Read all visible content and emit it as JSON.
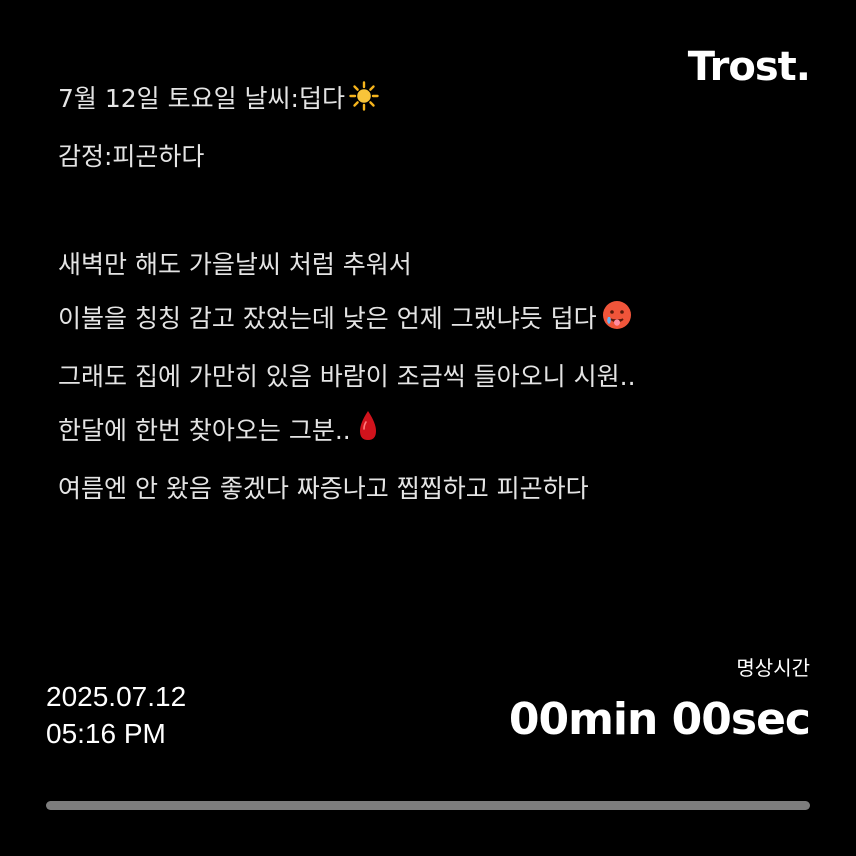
{
  "brand": {
    "logo": "Trost."
  },
  "entry": {
    "line1": "7월 12일 토요일 날씨:덥다",
    "line1_icon": "sun-emoji",
    "line2": "감정:피곤하다",
    "line3": "새벽만 해도 가을날씨 처럼 추워서",
    "line4": "이불을 칭칭 감고 잤었는데 낮은 언제 그랬냐듯 덥다",
    "line4_icon": "hot-face-emoji",
    "line5": "그래도 집에 가만히 있음 바람이 조금씩 들아오니 시원..",
    "line6": "한달에 한번 찾아오는 그분..",
    "line6_icon": "drop-of-blood-emoji",
    "line7": "여름엔 안 왔음 좋겠다 짜증나고 찝찝하고 피곤하다"
  },
  "meta": {
    "date": "2025.07.12",
    "time": "05:16 PM"
  },
  "meditation": {
    "label": "명상시간",
    "timer": "00min 00sec",
    "progress": 0
  },
  "colors": {
    "background": "#000000",
    "text": "#ffffff",
    "progress_track": "#7d7d7d",
    "progress_fill": "#ffffff",
    "sun": "#f6b41c",
    "hot_face": "#f0553a",
    "blood": "#d0131c"
  }
}
